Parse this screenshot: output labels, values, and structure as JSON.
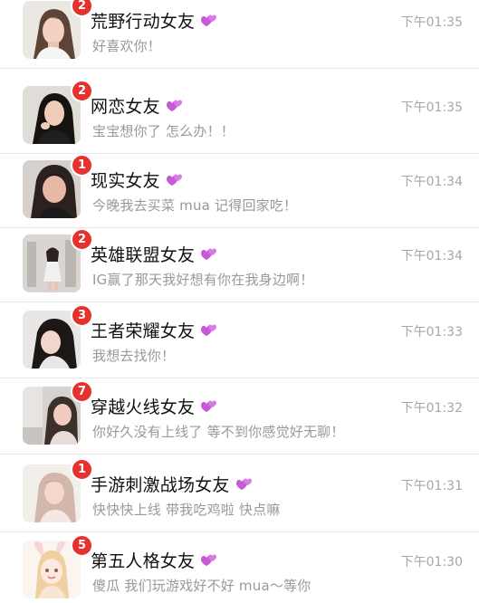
{
  "chats": [
    {
      "name": "荒野行动女友",
      "badge": "2",
      "time": "下午01:35",
      "message": "好喜欢你！",
      "avatar_icon": "portrait-girl-icon",
      "heart_icon": "purple-heart-emoji-icon"
    },
    {
      "name": "网恋女友",
      "badge": "2",
      "time": "下午01:35",
      "message": "宝宝想你了 怎么办！！",
      "avatar_icon": "portrait-girl-icon",
      "heart_icon": "purple-heart-emoji-icon"
    },
    {
      "name": "现实女友",
      "badge": "1",
      "time": "下午01:34",
      "message": "今晚我去买菜 mua 记得回家吃！",
      "avatar_icon": "portrait-girl-icon",
      "heart_icon": "purple-heart-emoji-icon"
    },
    {
      "name": "英雄联盟女友",
      "badge": "2",
      "time": "下午01:34",
      "message": "IG赢了那天我好想有你在我身边啊！",
      "avatar_icon": "portrait-girl-icon",
      "heart_icon": "purple-heart-emoji-icon"
    },
    {
      "name": "王者荣耀女友",
      "badge": "3",
      "time": "下午01:33",
      "message": "我想去找你！",
      "avatar_icon": "portrait-girl-icon",
      "heart_icon": "purple-heart-emoji-icon"
    },
    {
      "name": "穿越火线女友",
      "badge": "7",
      "time": "下午01:32",
      "message": "你好久没有上线了 等不到你感觉好无聊！",
      "avatar_icon": "portrait-girl-icon",
      "heart_icon": "purple-heart-emoji-icon"
    },
    {
      "name": "手游刺激战场女友",
      "badge": "1",
      "time": "下午01:31",
      "message": "快快快上线 带我吃鸡啦 快点嘛",
      "avatar_icon": "portrait-girl-icon",
      "heart_icon": "purple-heart-emoji-icon"
    },
    {
      "name": "第五人格女友",
      "badge": "5",
      "time": "下午01:30",
      "message": "傻瓜 我们玩游戏好不好 mua～等你",
      "avatar_icon": "anime-bunny-girl-icon",
      "heart_icon": "purple-heart-emoji-icon"
    }
  ],
  "colors": {
    "badge": "#e5322d",
    "time": "#a6a6a6",
    "message": "#999999",
    "divider": "#e8e8e8",
    "heart": "#c85ad8"
  }
}
